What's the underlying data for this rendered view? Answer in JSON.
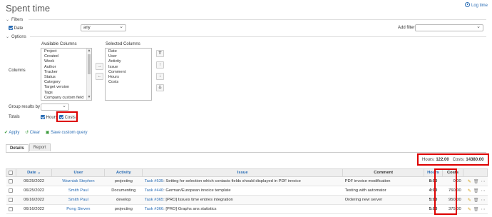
{
  "header": {
    "title": "Spent time",
    "log_time": "Log time"
  },
  "filters": {
    "legend": "Filters",
    "date_label": "Date",
    "date_operator": "any",
    "add_filter_label": "Add filter"
  },
  "options": {
    "legend": "Options",
    "columns_label": "Columns",
    "available_label": "Available Columns",
    "selected_label": "Selected Columns",
    "available": [
      "Project",
      "Created",
      "Week",
      "Author",
      "Tracker",
      "Status",
      "Category",
      "Target version",
      "Tags",
      "Company custom field"
    ],
    "selected": [
      "Date",
      "User",
      "Activity",
      "Issue",
      "Comment",
      "Hours",
      "Costs"
    ],
    "move_right": "→",
    "move_left": "←",
    "order_buttons": [
      "⇈",
      "↑",
      "↓",
      "⇊"
    ],
    "group_by_label": "Group results by",
    "totals_label": "Totals",
    "totals_hours": "Hours",
    "totals_costs": "Costs"
  },
  "actions": {
    "apply": "Apply",
    "clear": "Clear",
    "save": "Save custom query"
  },
  "tabs": [
    "Details",
    "Report"
  ],
  "summary": {
    "hours_label": "Hours:",
    "hours_value": "122.00",
    "costs_label": "Costs:",
    "costs_value": "14380.00"
  },
  "table": {
    "headers": {
      "date": "Date",
      "user": "User",
      "activity": "Activity",
      "issue": "Issue",
      "comment": "Comment",
      "hours": "Hours",
      "costs": "Costs"
    },
    "rows": [
      {
        "date": "06/25/2022",
        "user": "Wozniak Stephen",
        "activity": "projecting",
        "issue_link": "Task #535",
        "issue_text": ": Setting for selection which contacts fields should displayed in PDF invoice",
        "comment": "PDF invoice modification",
        "hours": "8:00",
        "costs": "0.00"
      },
      {
        "date": "06/25/2022",
        "user": "Smith Paul",
        "activity": "Documenting",
        "issue_link": "Task #440",
        "issue_text": ": German/European invoice template",
        "comment": "Testing with automator",
        "hours": "4:00",
        "costs": "760.00"
      },
      {
        "date": "06/16/2022",
        "user": "Smith Paul",
        "activity": "develop",
        "issue_link": "Task #365",
        "issue_text": ": [PRO] Issues time entries integration",
        "comment": "Ordering new server",
        "hours": "5:00",
        "costs": "950.00"
      },
      {
        "date": "06/16/2022",
        "user": "Pong Steven",
        "activity": "projecting",
        "issue_link": "Task #366",
        "issue_text": ": [PRO] Graphs ans statistics",
        "comment": "",
        "hours": "5:00",
        "costs": "375.00"
      }
    ]
  },
  "colors": {
    "link": "#2a6db5",
    "highlight": "#dd0000",
    "apply_green": "#3a9a3a"
  }
}
